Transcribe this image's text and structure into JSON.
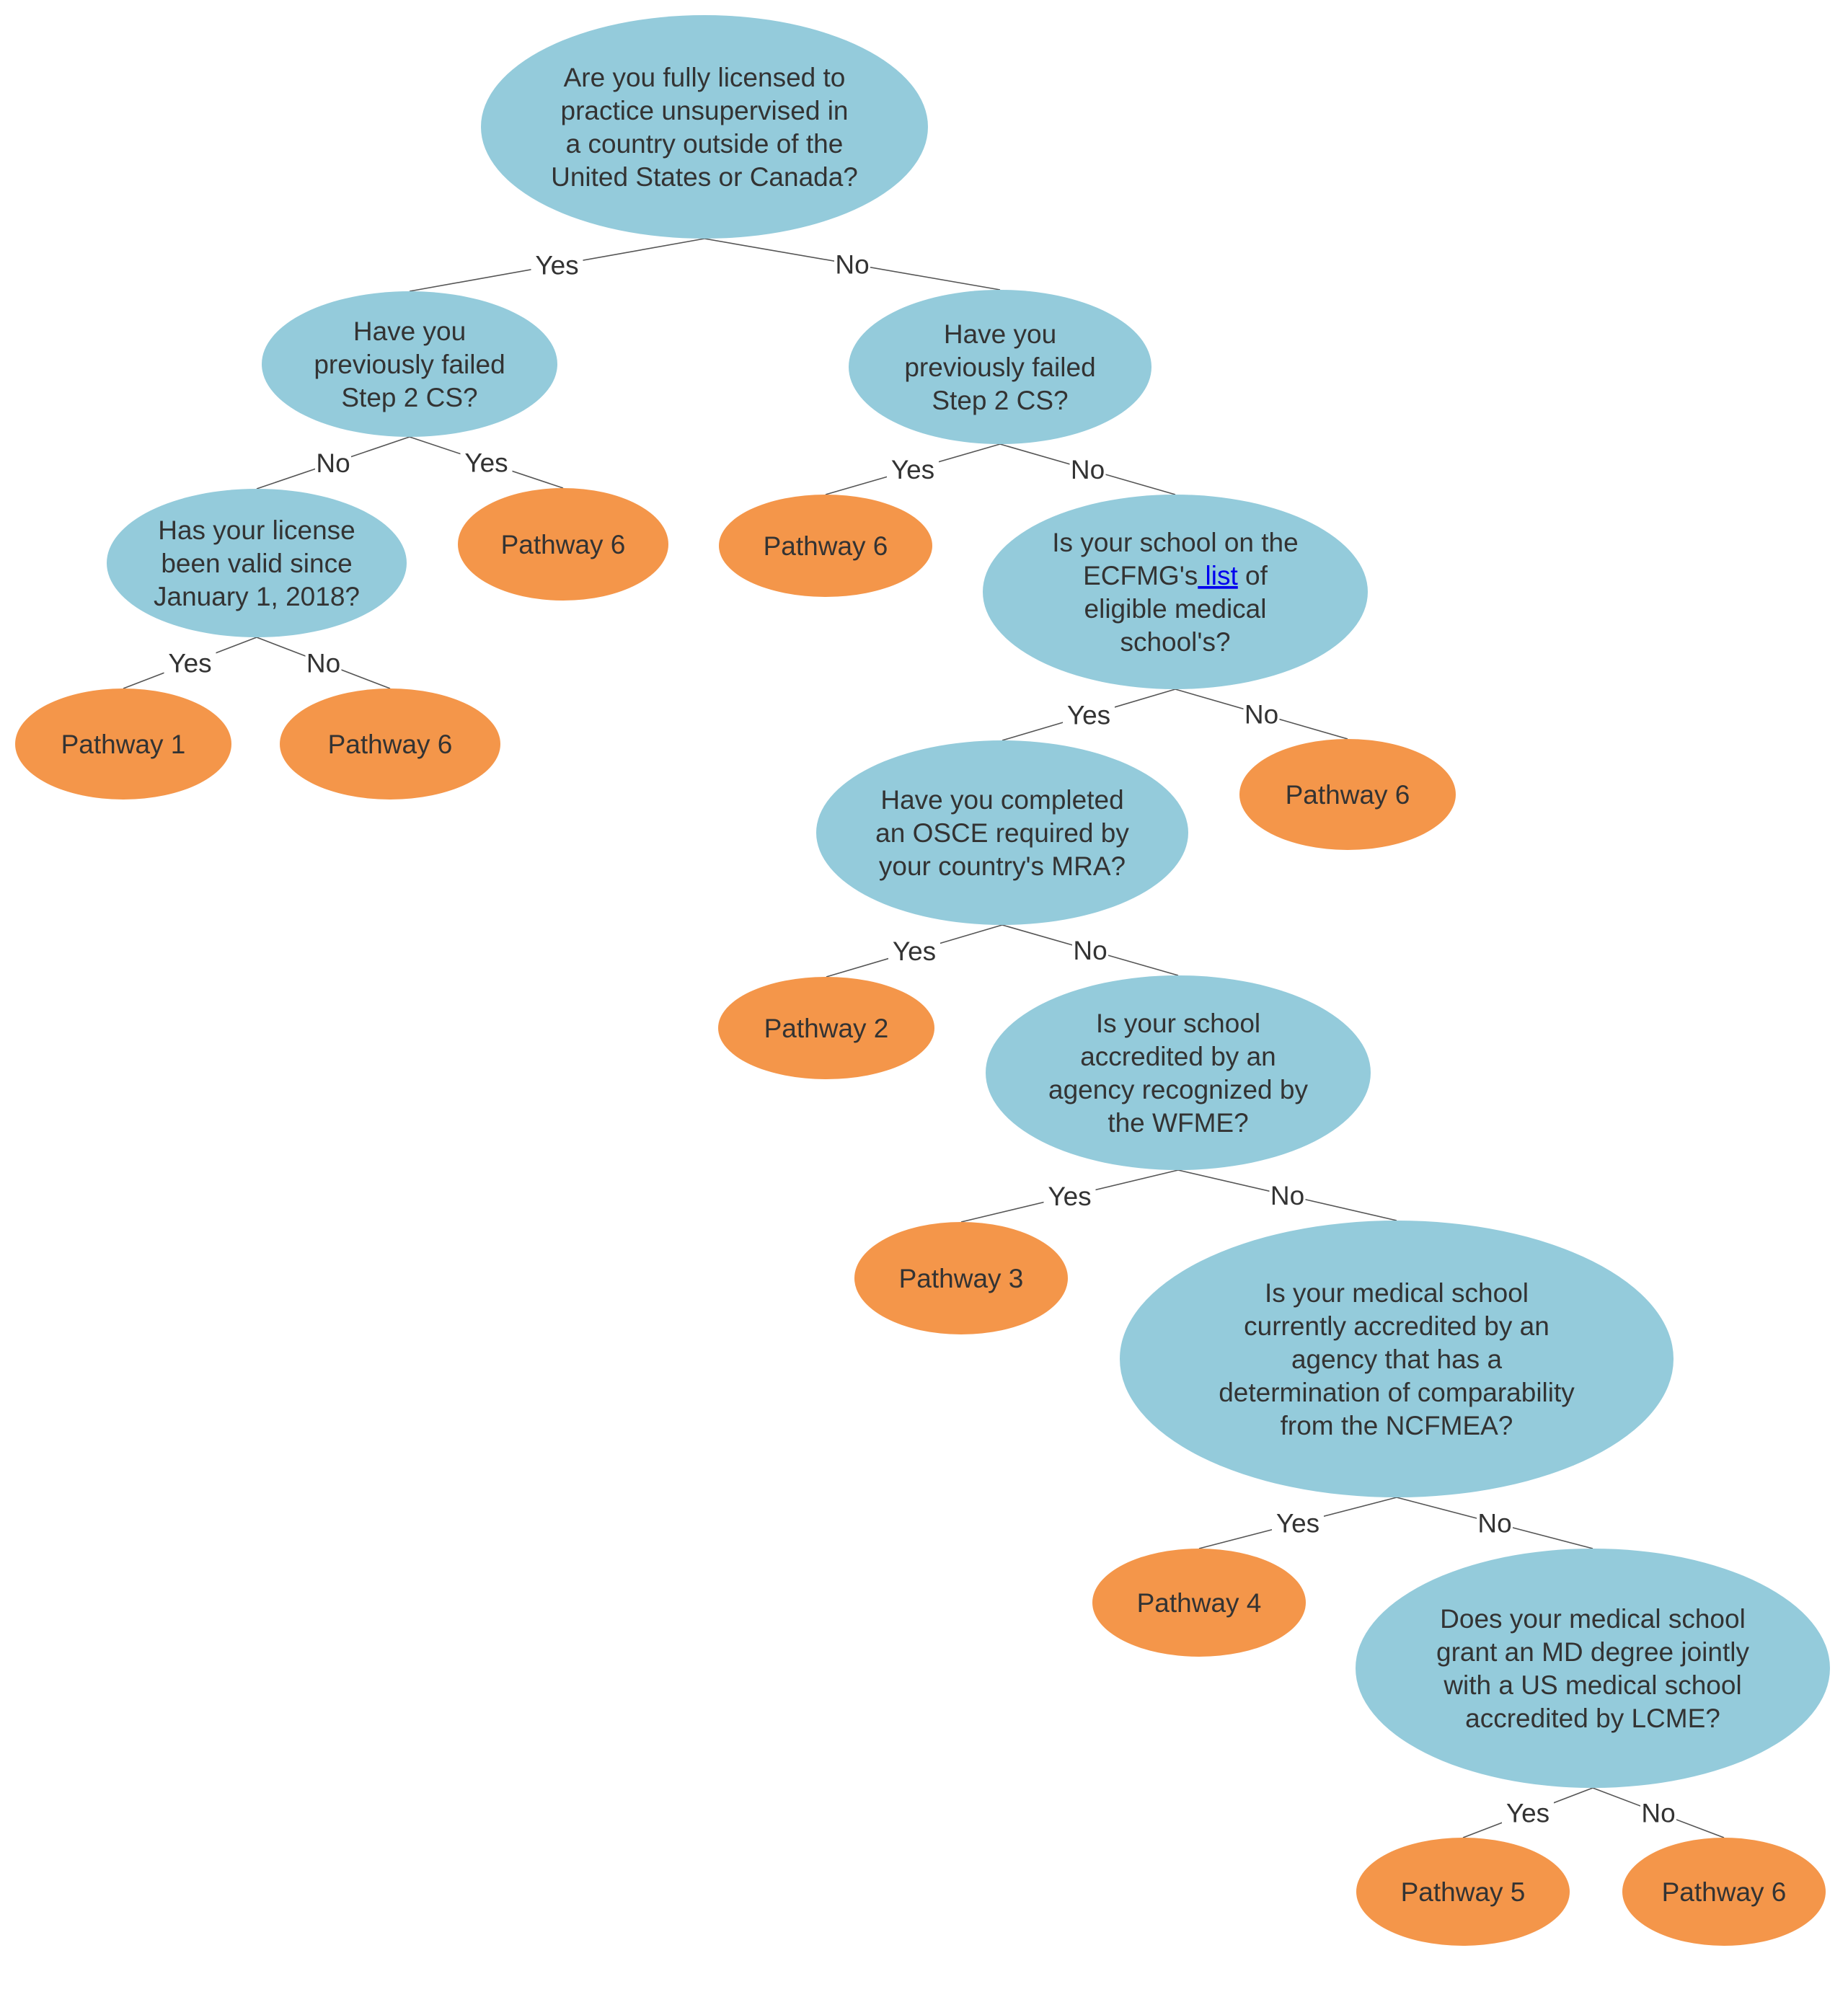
{
  "colors": {
    "question_fill": "#94cbdb",
    "pathway_fill": "#f4964a",
    "text": "#333333",
    "link": "#0000ee",
    "edge": "#555555"
  },
  "nodes": [
    {
      "id": "root",
      "type": "question",
      "lines": [
        "Are you fully licensed to",
        "practice unsupervised in",
        "a country outside of the",
        "United States or Canada?"
      ]
    },
    {
      "id": "q_failed_licensed",
      "type": "question",
      "lines": [
        "Have you",
        "previously failed",
        "Step 2 CS?"
      ]
    },
    {
      "id": "q_failed_unlicensed",
      "type": "question",
      "lines": [
        "Have you",
        "previously failed",
        "Step 2 CS?"
      ]
    },
    {
      "id": "q_license_valid",
      "type": "question",
      "lines": [
        "Has your license",
        "been valid since",
        "January 1, 2018?"
      ]
    },
    {
      "id": "p6_a",
      "type": "pathway",
      "lines": [
        "Pathway 6"
      ]
    },
    {
      "id": "p6_b",
      "type": "pathway",
      "lines": [
        "Pathway 6"
      ]
    },
    {
      "id": "q_ecfmg_list",
      "type": "question",
      "lines": [
        "Is your school on the",
        "ECFMG's| list| of",
        "eligible medical",
        "school's?"
      ],
      "link_text": " list"
    },
    {
      "id": "p1",
      "type": "pathway",
      "lines": [
        "Pathway 1"
      ]
    },
    {
      "id": "p6_c",
      "type": "pathway",
      "lines": [
        "Pathway 6"
      ]
    },
    {
      "id": "q_osce",
      "type": "question",
      "lines": [
        "Have you completed",
        "an OSCE required by",
        "your country's MRA?"
      ]
    },
    {
      "id": "p6_d",
      "type": "pathway",
      "lines": [
        "Pathway 6"
      ]
    },
    {
      "id": "p2",
      "type": "pathway",
      "lines": [
        "Pathway 2"
      ]
    },
    {
      "id": "q_wfme",
      "type": "question",
      "lines": [
        "Is your school",
        "accredited by an",
        "agency recognized by",
        "the WFME?"
      ]
    },
    {
      "id": "p3",
      "type": "pathway",
      "lines": [
        "Pathway 3"
      ]
    },
    {
      "id": "q_ncfmea",
      "type": "question",
      "lines": [
        "Is your medical school",
        "currently accredited by an",
        "agency that has a",
        "determination of comparability",
        "from the NCFMEA?"
      ]
    },
    {
      "id": "p4",
      "type": "pathway",
      "lines": [
        "Pathway 4"
      ]
    },
    {
      "id": "q_lcme",
      "type": "question",
      "lines": [
        "Does your medical school",
        "grant an MD degree jointly",
        "with a US medical school",
        "accredited by LCME?"
      ]
    },
    {
      "id": "p5",
      "type": "pathway",
      "lines": [
        "Pathway 5"
      ]
    },
    {
      "id": "p6_e",
      "type": "pathway",
      "lines": [
        "Pathway 6"
      ]
    }
  ],
  "edges": [
    {
      "from": "root",
      "to": "q_failed_licensed",
      "label": "Yes"
    },
    {
      "from": "root",
      "to": "q_failed_unlicensed",
      "label": "No"
    },
    {
      "from": "q_failed_licensed",
      "to": "q_license_valid",
      "label": "No"
    },
    {
      "from": "q_failed_licensed",
      "to": "p6_a",
      "label": "Yes"
    },
    {
      "from": "q_failed_unlicensed",
      "to": "p6_b",
      "label": "Yes"
    },
    {
      "from": "q_failed_unlicensed",
      "to": "q_ecfmg_list",
      "label": "No"
    },
    {
      "from": "q_license_valid",
      "to": "p1",
      "label": "Yes"
    },
    {
      "from": "q_license_valid",
      "to": "p6_c",
      "label": "No"
    },
    {
      "from": "q_ecfmg_list",
      "to": "q_osce",
      "label": "Yes"
    },
    {
      "from": "q_ecfmg_list",
      "to": "p6_d",
      "label": "No"
    },
    {
      "from": "q_osce",
      "to": "p2",
      "label": "Yes"
    },
    {
      "from": "q_osce",
      "to": "q_wfme",
      "label": "No"
    },
    {
      "from": "q_wfme",
      "to": "p3",
      "label": "Yes"
    },
    {
      "from": "q_wfme",
      "to": "q_ncfmea",
      "label": "No"
    },
    {
      "from": "q_ncfmea",
      "to": "p4",
      "label": "Yes"
    },
    {
      "from": "q_ncfmea",
      "to": "q_lcme",
      "label": "No"
    },
    {
      "from": "q_lcme",
      "to": "p5",
      "label": "Yes"
    },
    {
      "from": "q_lcme",
      "to": "p6_e",
      "label": "No"
    }
  ]
}
